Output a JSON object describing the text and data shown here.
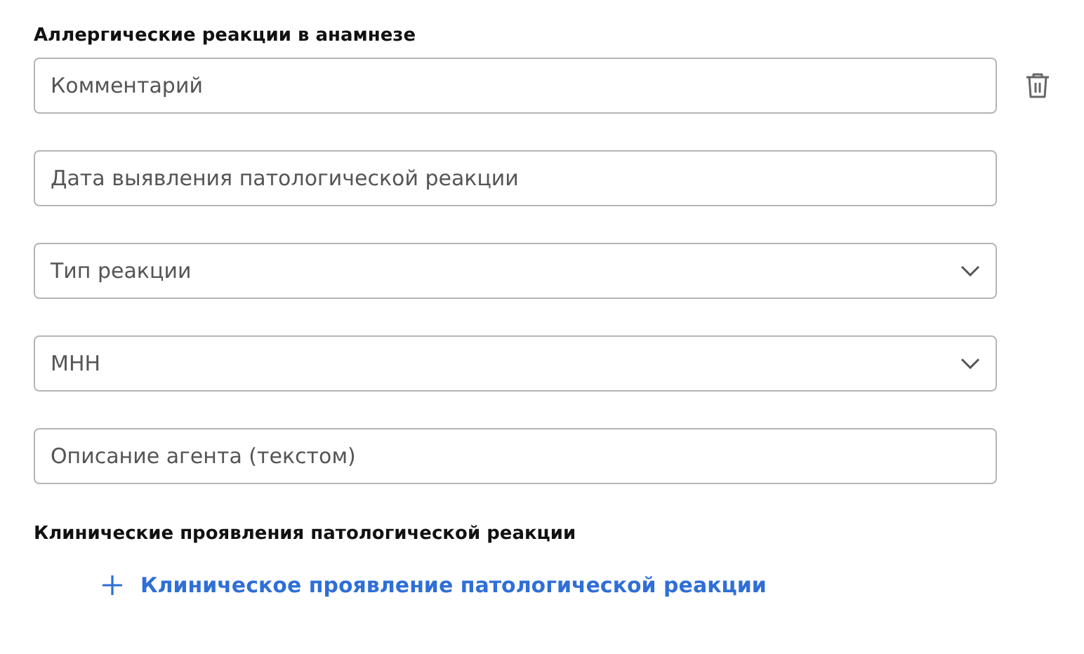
{
  "section_title": "Аллергические реакции в анамнезе",
  "fields": [
    {
      "kind": "text",
      "placeholder": "Комментарий",
      "removable": true
    },
    {
      "kind": "text",
      "placeholder": "Дата выявления патологической реакции",
      "removable": false
    },
    {
      "kind": "select",
      "placeholder": "Тип реакции",
      "removable": false
    },
    {
      "kind": "select",
      "placeholder": "МНН",
      "removable": false
    },
    {
      "kind": "text",
      "placeholder": "Описание агента (текстом)",
      "removable": false
    }
  ],
  "subsection_title": "Клинические проявления патологической реакции",
  "add_link": {
    "label": "Клиническое проявление патологической реакции"
  }
}
